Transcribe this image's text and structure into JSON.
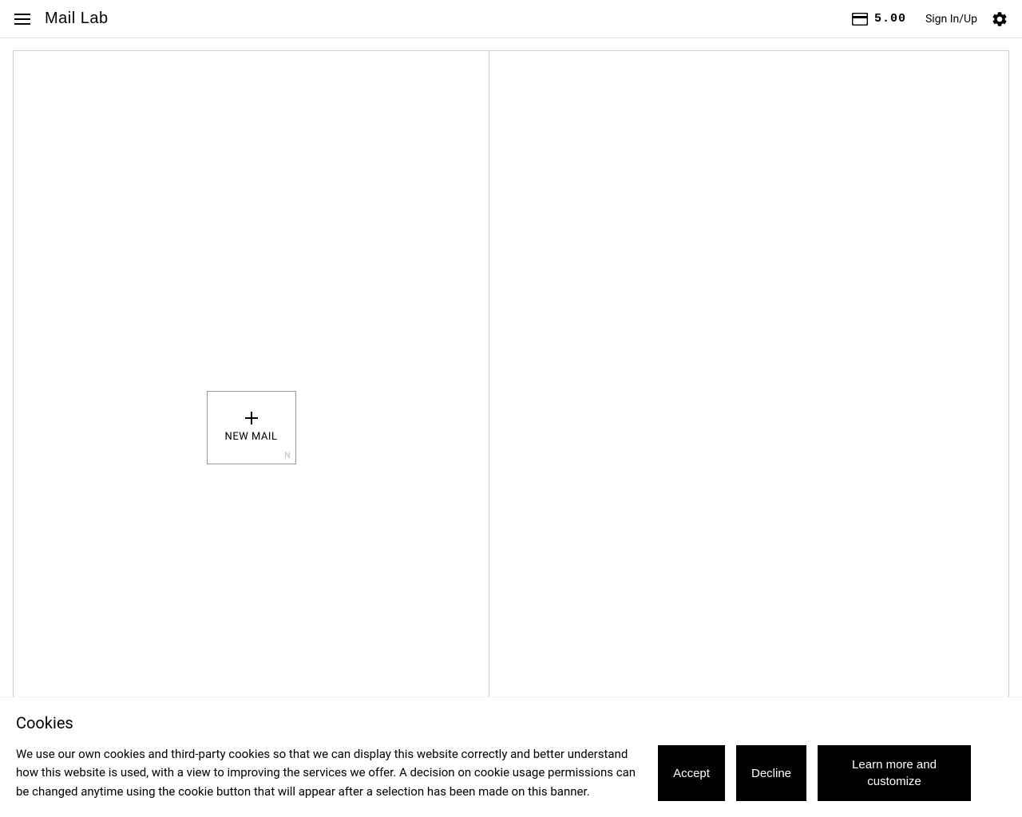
{
  "header": {
    "logo": "Mail Lab",
    "credit_amount": "5.00",
    "sign_in_label": "Sign In/Up"
  },
  "main": {
    "new_mail_label": "NEW MAIL",
    "new_mail_shortcut": "N"
  },
  "cookies": {
    "title": "Cookies",
    "text": "We use our own cookies and third-party cookies so that we can display this website correctly and better understand how this website is used, with a view to improving the services we offer. A decision on cookie usage permissions can be changed anytime using the cookie button that will appear after a selection has been made on this banner.",
    "accept_label": "Accept",
    "decline_label": "Decline",
    "learn_label": "Learn more and customize"
  }
}
